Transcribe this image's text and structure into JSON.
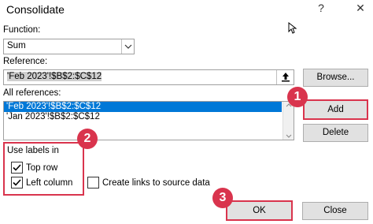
{
  "window": {
    "title": "Consolidate",
    "help_glyph": "?",
    "close_glyph": "✕"
  },
  "function": {
    "label": "Function:",
    "value": "Sum"
  },
  "reference": {
    "label": "Reference:",
    "value": "'Feb 2023'!$B$2:$C$12",
    "browse_label": "Browse..."
  },
  "all_references": {
    "label": "All references:",
    "items": [
      {
        "text": "'Feb 2023'!$B$2:$C$12",
        "selected": true
      },
      {
        "text": "'Jan 2023'!$B$2:$C$12",
        "selected": false
      }
    ],
    "add_label": "Add",
    "delete_label": "Delete"
  },
  "labels": {
    "group_label": "Use labels in",
    "top_row": {
      "label": "Top row",
      "checked": true
    },
    "left_column": {
      "label": "Left column",
      "checked": true
    },
    "create_links": {
      "label": "Create links to source data",
      "checked": false
    }
  },
  "footer": {
    "ok_label": "OK",
    "close_label": "Close"
  },
  "markers": [
    "1",
    "2",
    "3"
  ],
  "colors": {
    "highlight": "#d9344d",
    "selection": "#0078d7"
  }
}
